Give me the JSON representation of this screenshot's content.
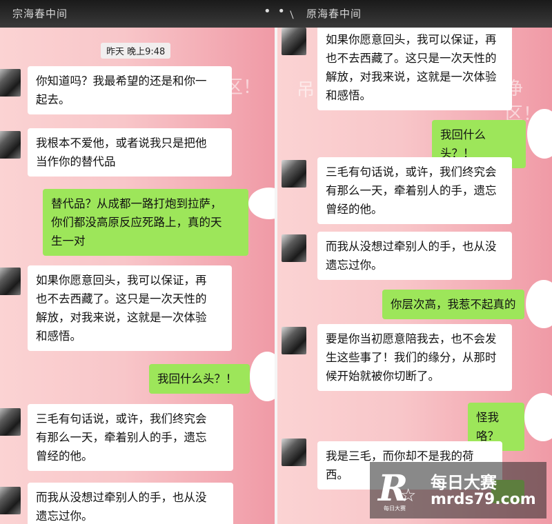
{
  "window": {
    "left_title": "宗海春中间",
    "right_title": "原海春中间",
    "more_icon": "more-dots-icon",
    "back_icon": "back-arrow-icon"
  },
  "left_panel": {
    "timestamp": "昨天 晚上9:48",
    "watermarks": [
      "吊",
      "净区！"
    ],
    "messages": [
      {
        "side": "in",
        "text": "你知道吗？我最希望的还是和你一\n起去。"
      },
      {
        "side": "in",
        "text": "我根本不爱他，或者说我只是把他\n当作你的替代品"
      },
      {
        "side": "out",
        "text": "替代品？从成都一路打炮到拉萨，\n你们都没高原反应死路上，真的天\n生一对"
      },
      {
        "side": "in",
        "text": "如果你愿意回头，我可以保证，再\n也不去西藏了。这只是一次天性的\n解放，对我来说，这就是一次体验\n和感悟。"
      },
      {
        "side": "out",
        "text": "我回什么头？！"
      },
      {
        "side": "in",
        "text": "三毛有句话说，或许，我们终究会\n有那么一天，牵着别人的手，遗忘\n曾经的他。"
      },
      {
        "side": "in",
        "text": "而我从没想过牵别人的手，也从没\n遗忘过你。"
      }
    ]
  },
  "right_panel": {
    "watermarks": [
      "吊",
      "净区！"
    ],
    "messages": [
      {
        "side": "in",
        "text": "如果你愿意回头，我可以保证，再\n也不去西藏了。这只是一次天性的\n解放，对我来说，这就是一次体验\n和感悟。"
      },
      {
        "side": "out",
        "text": "我回什么头？！"
      },
      {
        "side": "in",
        "text": "三毛有句话说，或许，我们终究会\n有那么一天，牵着别人的手，遗忘\n曾经的他。"
      },
      {
        "side": "in",
        "text": "而我从没想过牵别人的手，也从没\n遗忘过你。"
      },
      {
        "side": "out",
        "text": "你层次高，我惹不起真的"
      },
      {
        "side": "in",
        "text": "要是你当初愿意陪我去，也不会发\n生这些事了！我们的缘分，从那时\n候开始就被你切断了。"
      },
      {
        "side": "out",
        "text": "怪我咯？"
      },
      {
        "side": "in",
        "text": "我是三毛，而你却不是我的荷西。"
      }
    ]
  },
  "logo": {
    "letter": "R",
    "small_text": "每日大赛",
    "name": "每日大赛",
    "url": "mrds79.com"
  },
  "colors": {
    "incoming_bubble": "#ffffff",
    "outgoing_bubble": "#9de65a",
    "background_pink": "#f8c6c9"
  }
}
